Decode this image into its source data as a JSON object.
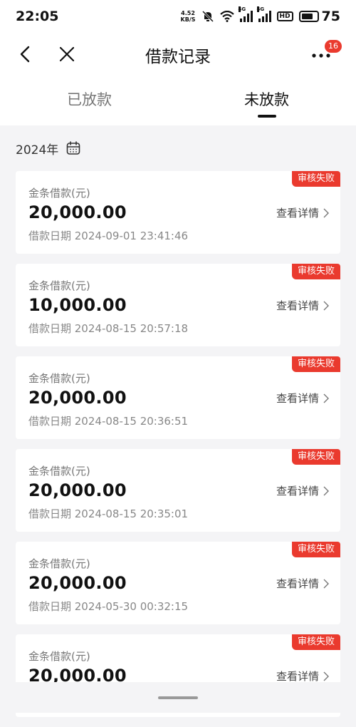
{
  "status_bar": {
    "time": "22:05",
    "net_speed_value": "4.52",
    "net_speed_unit": "KB/S",
    "signal_label_1": "4G",
    "signal_label_2": "4G",
    "hd_label": "HD",
    "battery": "75"
  },
  "nav": {
    "title": "借款记录",
    "more_badge": "16"
  },
  "tabs": [
    {
      "label": "已放款"
    },
    {
      "label": "未放款"
    }
  ],
  "year_label": "2024年",
  "records": [
    {
      "label": "金条借款(元)",
      "amount": "20,000.00",
      "date": "借款日期 2024-09-01 23:41:46",
      "detail": "查看详情",
      "status": "审核失败"
    },
    {
      "label": "金条借款(元)",
      "amount": "10,000.00",
      "date": "借款日期 2024-08-15 20:57:18",
      "detail": "查看详情",
      "status": "审核失败"
    },
    {
      "label": "金条借款(元)",
      "amount": "20,000.00",
      "date": "借款日期 2024-08-15 20:36:51",
      "detail": "查看详情",
      "status": "审核失败"
    },
    {
      "label": "金条借款(元)",
      "amount": "20,000.00",
      "date": "借款日期 2024-08-15 20:35:01",
      "detail": "查看详情",
      "status": "审核失败"
    },
    {
      "label": "金条借款(元)",
      "amount": "20,000.00",
      "date": "借款日期 2024-05-30 00:32:15",
      "detail": "查看详情",
      "status": "审核失败"
    },
    {
      "label": "金条借款(元)",
      "amount": "20,000.00",
      "date": "",
      "detail": "查看详情",
      "status": "审核失败"
    }
  ],
  "colors": {
    "status_red": "#ea3a2e",
    "background": "#f4f4f6"
  }
}
